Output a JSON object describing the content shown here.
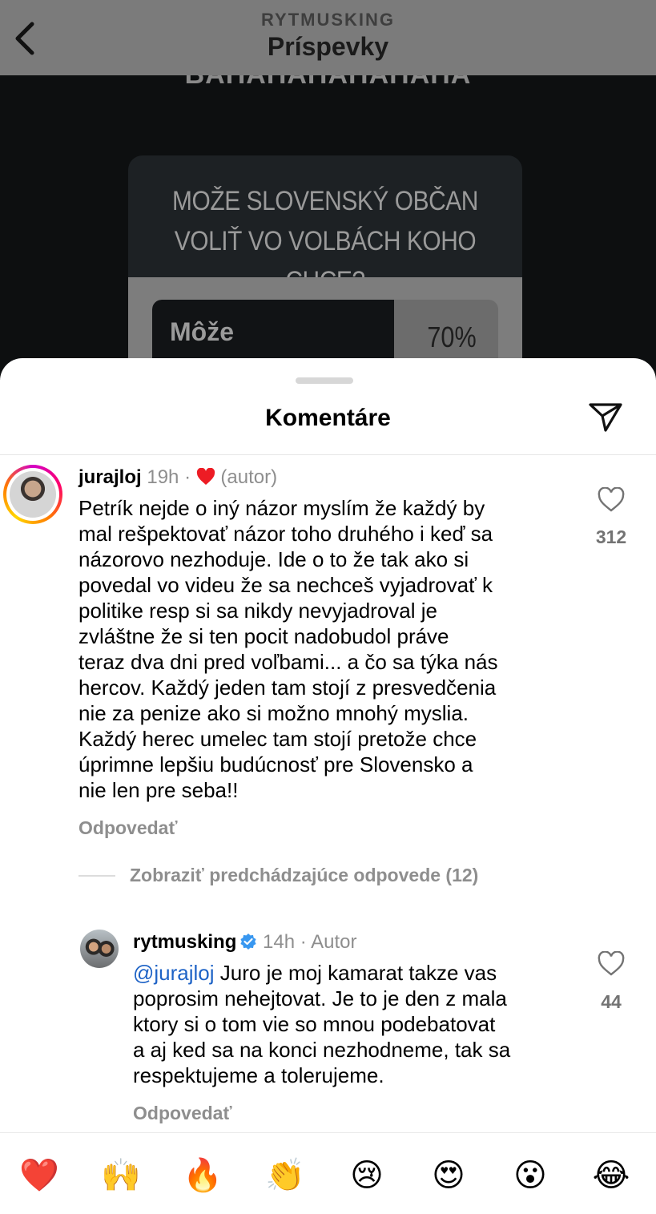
{
  "header": {
    "account": "RYTMUSKING",
    "title": "Príspevky"
  },
  "post": {
    "top_text": "BAHAHAHAHAHAHA",
    "poll_question": "MOŽE SLOVENSKÝ OBČAN VOLIŤ VO VOLBÁCH KOHO CHCE?",
    "poll_option": "Môže",
    "poll_percent": "70%",
    "poll_fraction": 0.7
  },
  "sheet": {
    "title": "Komentáre"
  },
  "comments": [
    {
      "username": "jurajloj",
      "time": "19h",
      "sep": "·",
      "author_tag": "(autor)",
      "text": "Petrík nejde o iný názor myslím že každý by\nmal rešpektovať názor toho druhého i keď sa\nnázorovo  nezhoduje. Ide o to že tak ako si\npovedal vo videu že sa nechceš vyjadrovať k\npolitike resp si sa nikdy nevyjadroval je\nzvláštne že si ten pocit nadobudol práve\nteraz dva dni pred voľbami... a čo sa týka nás\nhercov. Každý jeden tam stojí z presvedčenia\nnie za penize ako si možno mnohý myslia.\nKaždý herec umelec tam stojí pretože chce\núprimne lepšiu budúcnosť pre Slovensko a\nnie len pre seba!!",
      "likes": "312",
      "reply_label": "Odpovedať"
    }
  ],
  "view_replies": "Zobraziť predchádzajúce odpovede (12)",
  "reply": {
    "username": "rytmusking",
    "time": "14h",
    "sep": "·",
    "author_tag": "Autor",
    "mention": "@jurajloj",
    "text": " Juro je moj kamarat takze vas\npoprosim nehejtovat. Je to je den z mala\nktory si o tom vie so mnou podebatovat\na aj ked sa na konci nezhodneme, tak sa\nrespektujeme a tolerujeme.",
    "likes": "44",
    "reply_label": "Odpovedať"
  },
  "emoji_bar": [
    "❤️",
    "🙌",
    "🔥",
    "👏",
    "😢",
    "😍",
    "😮",
    "😂"
  ],
  "colors": {
    "accent_heart": "#ed1c24",
    "mention": "#1e63c6",
    "verified": "#3897f0"
  }
}
